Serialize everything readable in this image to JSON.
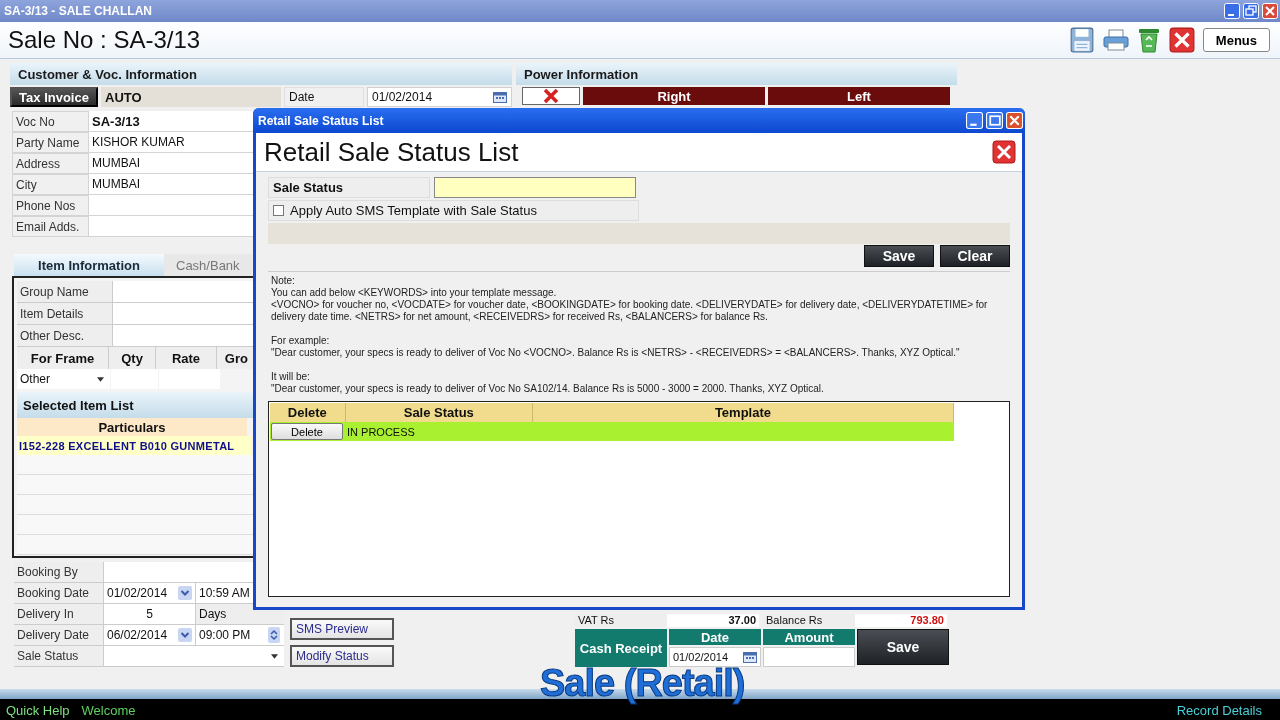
{
  "window": {
    "title": "SA-3/13 - SALE CHALLAN"
  },
  "header": {
    "title": "Sale No : SA-3/13",
    "menu_button": "Menus"
  },
  "customer": {
    "heading": "Customer & Voc. Information",
    "invoice_type": "Tax Invoice",
    "invoice_value": "AUTO",
    "date_label": "Date",
    "date_value": "01/02/2014",
    "fields": [
      {
        "label": "Voc No",
        "value": "SA-3/13",
        "bold": true
      },
      {
        "label": "Party Name",
        "value": "KISHOR KUMAR",
        "bold": false
      },
      {
        "label": "Address",
        "value": "MUMBAI",
        "bold": false
      },
      {
        "label": "City",
        "value": "MUMBAI",
        "bold": false
      },
      {
        "label": "Phone Nos"
      },
      {
        "label": "Email Adds."
      }
    ]
  },
  "item_tabs": [
    {
      "label": "Item Information",
      "selected": true
    },
    {
      "label": "Cash/Bank",
      "selected": false
    }
  ],
  "item_form": {
    "fields": [
      "Group Name",
      "Item Details",
      "Other Desc."
    ],
    "columns": [
      "For Frame",
      "Qty",
      "Rate",
      "Gro"
    ],
    "frame_type": "Other"
  },
  "selected_items": {
    "heading": "Selected Item List",
    "column": "Particulars",
    "rows": [
      "I152-228 EXCELLENT B010 GUNMETAL"
    ]
  },
  "booking": {
    "booking_by": "Booking By",
    "booking_date": {
      "label": "Booking Date",
      "date": "01/02/2014",
      "time": "10:59 AM"
    },
    "delivery_in": {
      "label": "Delivery In",
      "value": "5",
      "unit": "Days"
    },
    "delivery_date": {
      "label": "Delivery Date",
      "date": "06/02/2014",
      "time": "09:00 PM"
    },
    "sale_status": "Sale Status"
  },
  "booking_buttons": [
    "SMS Preview",
    "Modify Status"
  ],
  "power": {
    "heading": "Power Information",
    "columns": [
      "Right",
      "Left"
    ]
  },
  "totals": {
    "vat_label": "VAT Rs",
    "vat_value": "37.00",
    "balance_label": "Balance Rs",
    "balance_value": "793.80"
  },
  "receipt": {
    "label": "Cash Receipt",
    "date_label": "Date",
    "date_value": "01/02/2014",
    "amount_label": "Amount",
    "save": "Save"
  },
  "caption": "Sale (Retail)",
  "status_bar": {
    "left": [
      "Quick Help",
      "Welcome"
    ],
    "right": "Record Details"
  },
  "dialog": {
    "title": "Retail Sale Status List",
    "heading": "Retail Sale Status List",
    "status_label": "Sale Status",
    "sms_template": {
      "label": "Apply Auto SMS Template with Sale Status",
      "checked": false
    },
    "buttons": [
      "Save",
      "Clear"
    ],
    "note": [
      {
        "lines": [
          "Note:",
          "You can add below <KEYWORDS> into your template message.",
          "<VOCNO> for voucher no, <VOCDATE> for voucher date, <BOOKINGDATE> for booking date. <DELIVERYDATE> for delivery date, <DELIVERYDATETIME> for delivery date time. <NETRS> for net amount, <RECEIVEDRS> for received Rs, <BALANCERS> for balance Rs."
        ]
      },
      {
        "lines": [
          "For example:",
          "\"Dear customer, your specs is ready to deliver of Voc No <VOCNO>. Balance Rs is <NETRS> - <RECEIVEDRS> = <BALANCERS>. Thanks, XYZ Optical.\""
        ]
      },
      {
        "lines": [
          "It will be:",
          "\"Dear customer, your specs is ready to deliver of Voc No SA102/14. Balance Rs is 5000 - 3000 = 2000. Thanks, XYZ Optical."
        ]
      }
    ],
    "table": {
      "columns": [
        "Delete",
        "Sale Status",
        "Template"
      ],
      "rows": [
        {
          "action": "Delete",
          "status": "IN PROCESS"
        }
      ]
    }
  }
}
